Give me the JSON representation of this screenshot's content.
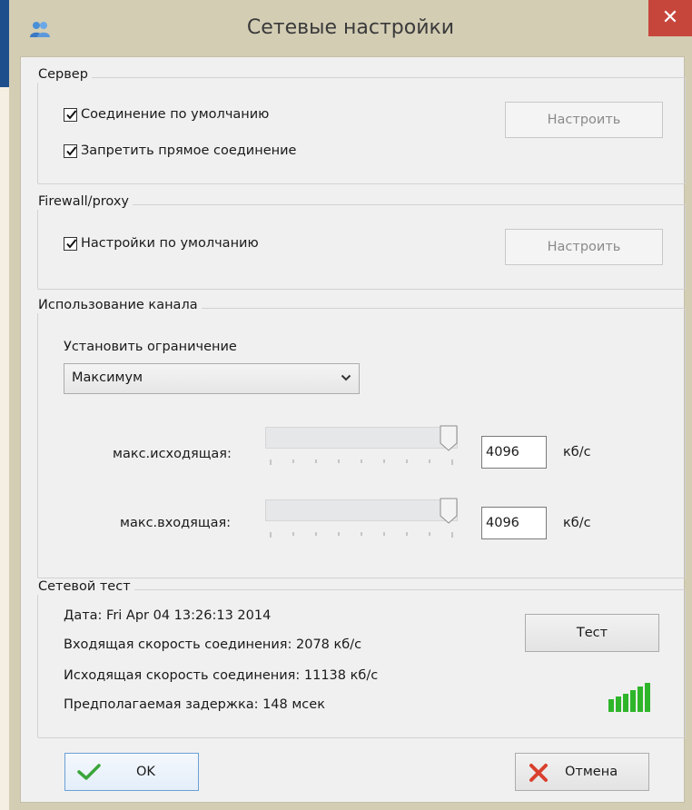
{
  "window": {
    "title": "Сетевые настройки",
    "close_glyph": "✕"
  },
  "server": {
    "title": "Сервер",
    "default_connection": {
      "label": "Соединение по умолчанию",
      "checked": true
    },
    "forbid_direct": {
      "label": "Запретить прямое соединение",
      "checked": true
    },
    "configure_button": "Настроить"
  },
  "firewall": {
    "title": "Firewall/proxy",
    "default_settings": {
      "label": "Настройки по умолчанию",
      "checked": true
    },
    "configure_button": "Настроить"
  },
  "channel": {
    "title": "Использование канала",
    "limit_label": "Установить ограничение",
    "limit_value": "Максимум",
    "max_outgoing": {
      "label": "макс.исходящая:",
      "value": "4096",
      "unit": "кб/с",
      "level": 1.0
    },
    "max_incoming": {
      "label": "макс.входящая:",
      "value": "4096",
      "unit": "кб/с",
      "level": 1.0
    }
  },
  "network_test": {
    "title": "Сетевой тест",
    "date": "Дата: Fri Apr 04 13:26:13 2014",
    "incoming_speed": "Входящая скорость соединения: 2078 кб/с",
    "outgoing_speed": "Исходящая скорость соединения: 11138 кб/с",
    "latency": "Предполагаемая задержка: 148 мсек",
    "test_button": "Тест",
    "signal_bars": 6,
    "signal_color": "#2fb52a"
  },
  "footer": {
    "ok_button": "OK",
    "cancel_button": "Отмена"
  },
  "colors": {
    "desktop_blue": "#1f4e8c",
    "window_frame": "#d3cdb4",
    "close_red": "#c7463c",
    "ok_border": "#6aa0d8"
  }
}
